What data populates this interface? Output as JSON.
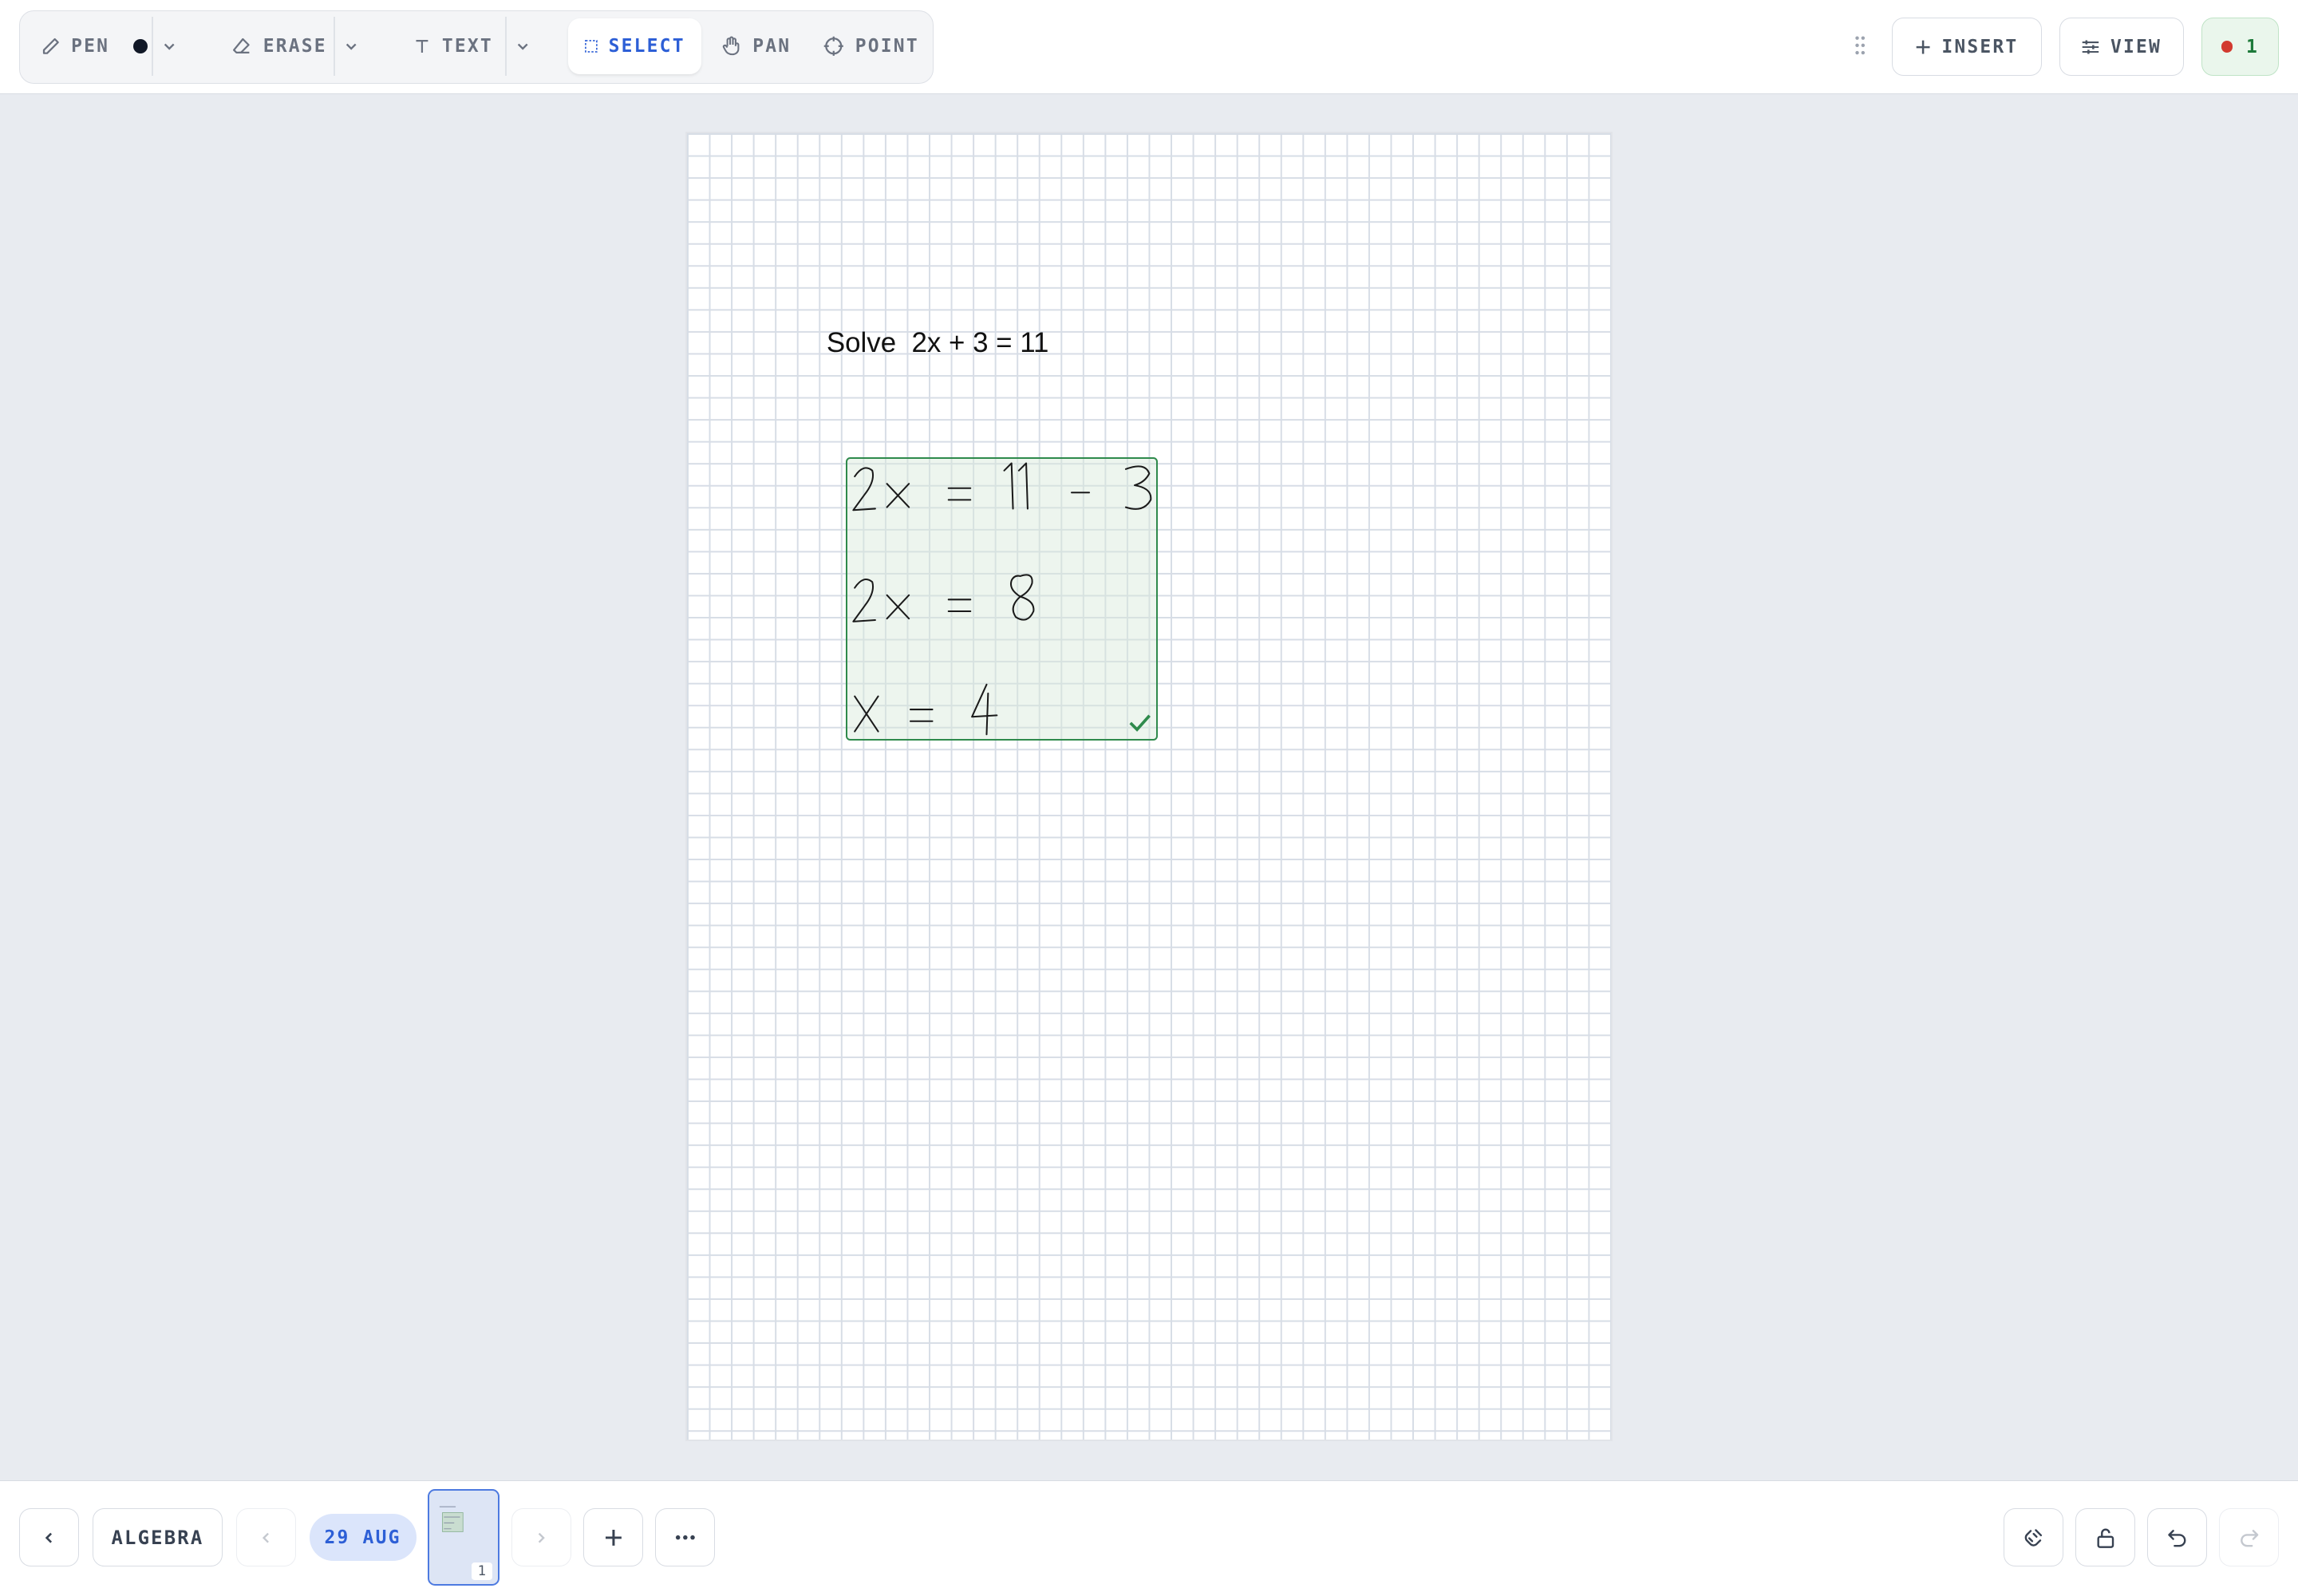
{
  "toolbar": {
    "pen_label": "PEN",
    "pen_color": "#111827",
    "erase_label": "ERASE",
    "text_label": "TEXT",
    "select_label": "SELECT",
    "pan_label": "PAN",
    "point_label": "POINT",
    "active_tool": "select",
    "insert_label": "INSERT",
    "view_label": "VIEW",
    "recording_count": "1",
    "icons": [
      "pen-icon",
      "eraser-icon",
      "text-icon",
      "select-icon",
      "hand-icon",
      "crosshair-icon",
      "plus-icon",
      "sliders-icon",
      "grip-icon"
    ]
  },
  "canvas": {
    "background": "grid",
    "problem_text": "Solve  2x + 3 = 11",
    "handwriting_lines": [
      "2x = 11 - 3",
      "2x = 8",
      "x = 4"
    ],
    "selection_color": "#2f8a4c",
    "accent": "#2d5fd6"
  },
  "bottombar": {
    "notebook_label": "ALGEBRA",
    "date_label": "29 AUG",
    "page_number": "1",
    "icons": [
      "chevron-left-icon",
      "add-page-icon",
      "more-icon",
      "snap-icon",
      "unlock-icon",
      "undo-icon",
      "redo-icon"
    ]
  }
}
